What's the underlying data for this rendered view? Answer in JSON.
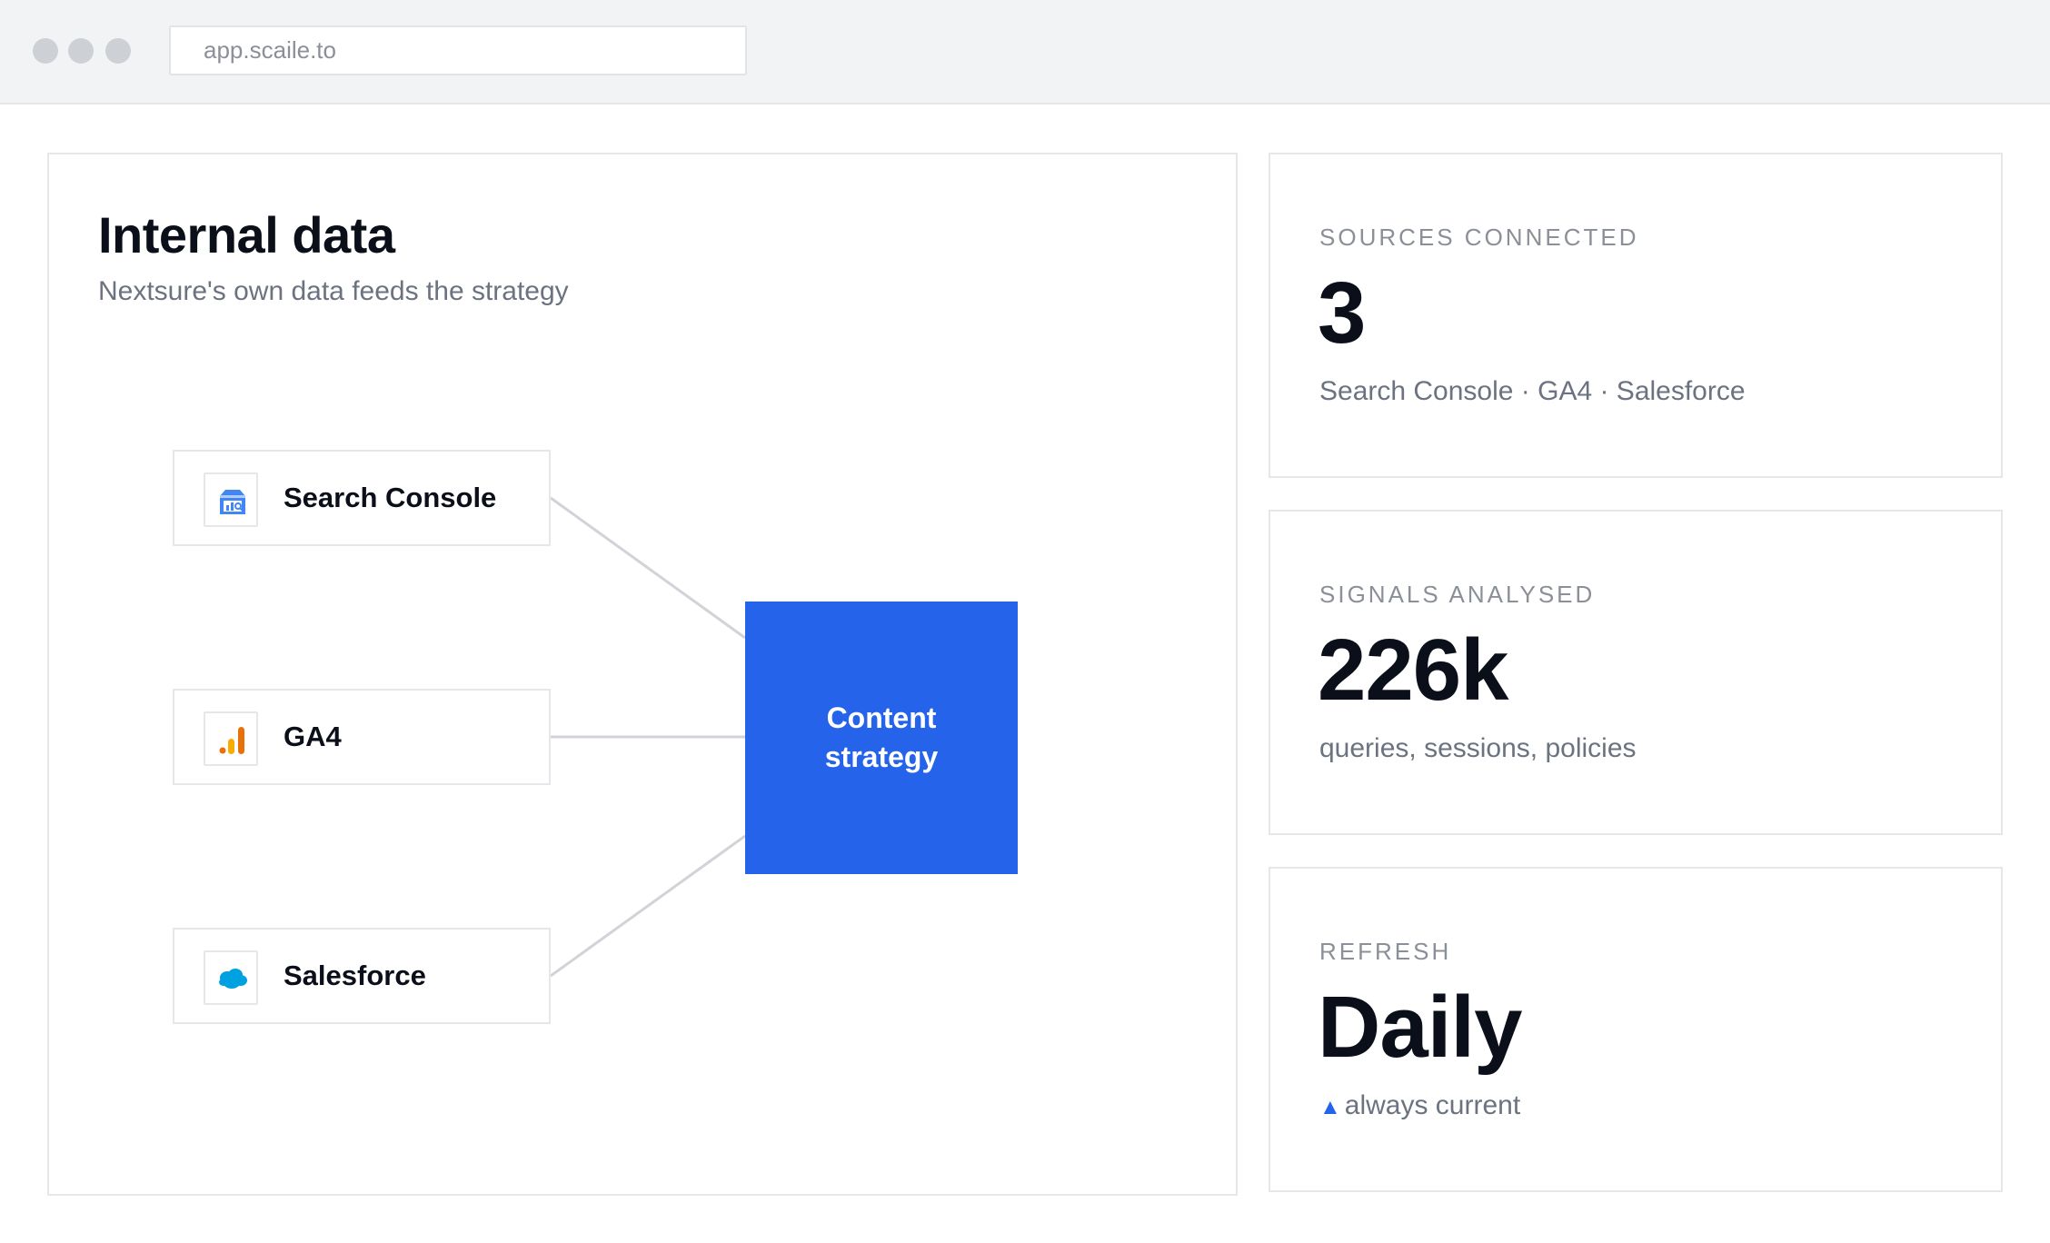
{
  "browser": {
    "url": "app.scaile.to"
  },
  "main": {
    "title": "Internal data",
    "subtitle": "Nextsure's own data feeds the strategy",
    "sources": [
      {
        "label": "Search Console",
        "icon": "search-console-icon"
      },
      {
        "label": "GA4",
        "icon": "ga4-icon"
      },
      {
        "label": "Salesforce",
        "icon": "salesforce-icon"
      }
    ],
    "hub_label": "Content strategy"
  },
  "stats": [
    {
      "label": "SOURCES CONNECTED",
      "value": "3",
      "note": "Search Console · GA4 · Salesforce"
    },
    {
      "label": "SIGNALS ANALYSED",
      "value": "226k",
      "note": "queries, sessions, policies"
    },
    {
      "label": "REFRESH",
      "value": "Daily",
      "note": "always current",
      "indicator": "up-triangle-icon"
    }
  ],
  "colors": {
    "accent": "#2563eb",
    "ga4_orange": "#e8710a",
    "salesforce_blue": "#00a1e0",
    "search_console_blue": "#4285f4"
  }
}
